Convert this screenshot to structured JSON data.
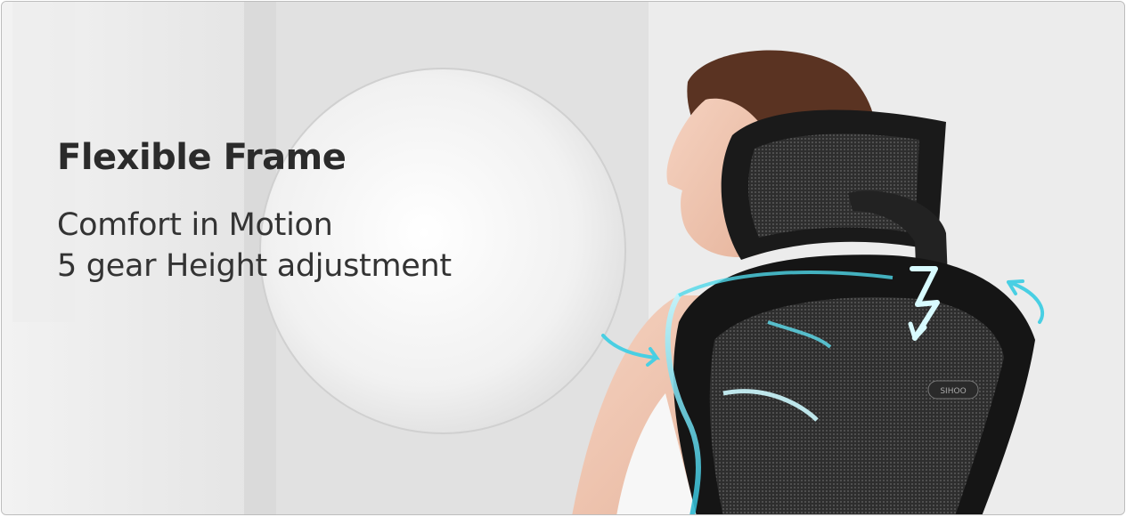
{
  "banner": {
    "title": "Flexible Frame",
    "subtitle_line1": "Comfort in Motion",
    "subtitle_line2": "5 gear Height adjustment",
    "chair_logo_text": "SIHOO"
  },
  "colors": {
    "text_dark": "#2b2b2b",
    "accent_glow": "#4fd8ea",
    "chair_black": "#1a1a1a",
    "background_gray": "#e6e6e6"
  },
  "icons": [
    "curved-motion-arrow-icon",
    "zigzag-height-arrow-icon"
  ]
}
